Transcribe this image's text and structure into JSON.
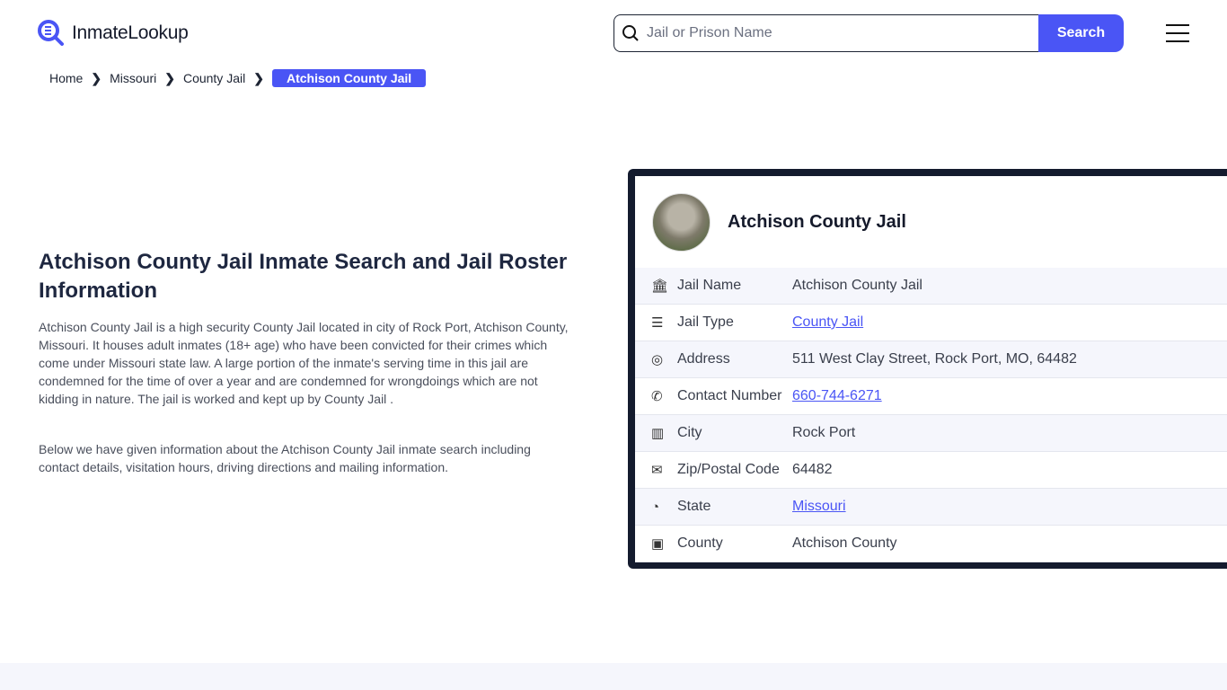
{
  "header": {
    "logo_text": "InmateLookup",
    "search_placeholder": "Jail or Prison Name",
    "search_label": "Search"
  },
  "breadcrumb": [
    {
      "label": "Home"
    },
    {
      "label": "Missouri"
    },
    {
      "label": "County Jail"
    },
    {
      "label": "Atchison County Jail"
    }
  ],
  "main": {
    "title": "Atchison County Jail Inmate Search and Jail Roster Information",
    "paragraphs": [
      "Atchison County Jail is a high security County Jail located in city of Rock Port, Atchison County, Missouri. It houses adult inmates (18+ age) who have been convicted for their crimes which come under Missouri state law. A large portion of the inmate's serving time in this jail are condemned for the time of over a year and are condemned for wrongdoings which are not kidding in nature. The jail is worked and kept up by County Jail .",
      "Below we have given information about the Atchison County Jail inmate search including contact details, visitation hours, driving directions and mailing information."
    ]
  },
  "card": {
    "title": "Atchison County Jail",
    "rows": [
      {
        "icon": "building-icon",
        "label": "Jail Name",
        "value": "Atchison County Jail"
      },
      {
        "icon": "list-icon",
        "label": "Jail Type",
        "value": "County Jail"
      },
      {
        "icon": "map-pin-icon",
        "label": "Address",
        "value": "511 West Clay Street, Rock Port, MO, 64482"
      },
      {
        "icon": "phone-icon",
        "label": "Contact Number",
        "value": "660-744-6271"
      },
      {
        "icon": "map-icon",
        "label": "City",
        "value": "Rock Port"
      },
      {
        "icon": "mail-icon",
        "label": "Zip/Postal Code",
        "value": "64482"
      },
      {
        "icon": "globe-icon",
        "label": "State",
        "value": "Missouri"
      },
      {
        "icon": "county-icon",
        "label": "County",
        "value": "Atchison County"
      }
    ]
  },
  "colors": {
    "accent": "#4a55f5",
    "card_border": "#141b2e"
  }
}
